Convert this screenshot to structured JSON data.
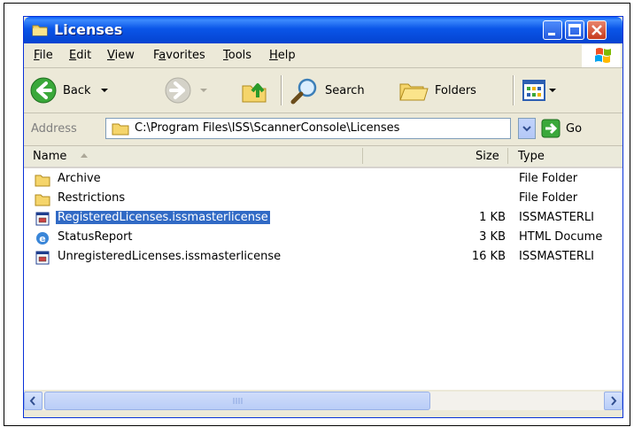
{
  "window": {
    "title": "Licenses",
    "title_icon": "folder-icon"
  },
  "titlebar_buttons": [
    "minimize-icon",
    "maximize-icon",
    "close-icon"
  ],
  "menu": [
    {
      "label": "File",
      "accel": "F",
      "rest": "ile"
    },
    {
      "label": "Edit",
      "accel": "E",
      "rest": "dit"
    },
    {
      "label": "View",
      "accel": "V",
      "rest": "iew"
    },
    {
      "label": "Favorites",
      "pre": "F",
      "accel": "a",
      "rest": "vorites"
    },
    {
      "label": "Tools",
      "accel": "T",
      "rest": "ools"
    },
    {
      "label": "Help",
      "accel": "H",
      "rest": "elp"
    }
  ],
  "toolbar": {
    "back_label": "Back",
    "search_label": "Search",
    "folders_label": "Folders"
  },
  "address": {
    "label": "Address",
    "path": "C:\\Program Files\\ISS\\ScannerConsole\\Licenses",
    "go_label": "Go"
  },
  "columns": {
    "name": "Name",
    "size": "Size",
    "type": "Type"
  },
  "files": [
    {
      "name": "Archive",
      "size": "",
      "type": "File Folder",
      "icon": "folder-icon",
      "selected": false
    },
    {
      "name": "Restrictions",
      "size": "",
      "type": "File Folder",
      "icon": "folder-icon",
      "selected": false
    },
    {
      "name": "RegisteredLicenses.issmasterlicense",
      "size": "1 KB",
      "type": "ISSMASTERLI",
      "icon": "license-file-icon",
      "selected": true
    },
    {
      "name": "StatusReport",
      "size": "3 KB",
      "type": "HTML Docume",
      "icon": "html-document-icon",
      "selected": false
    },
    {
      "name": "UnregisteredLicenses.issmasterlicense",
      "size": "16 KB",
      "type": "ISSMASTERLI",
      "icon": "license-file-icon",
      "selected": false
    }
  ]
}
